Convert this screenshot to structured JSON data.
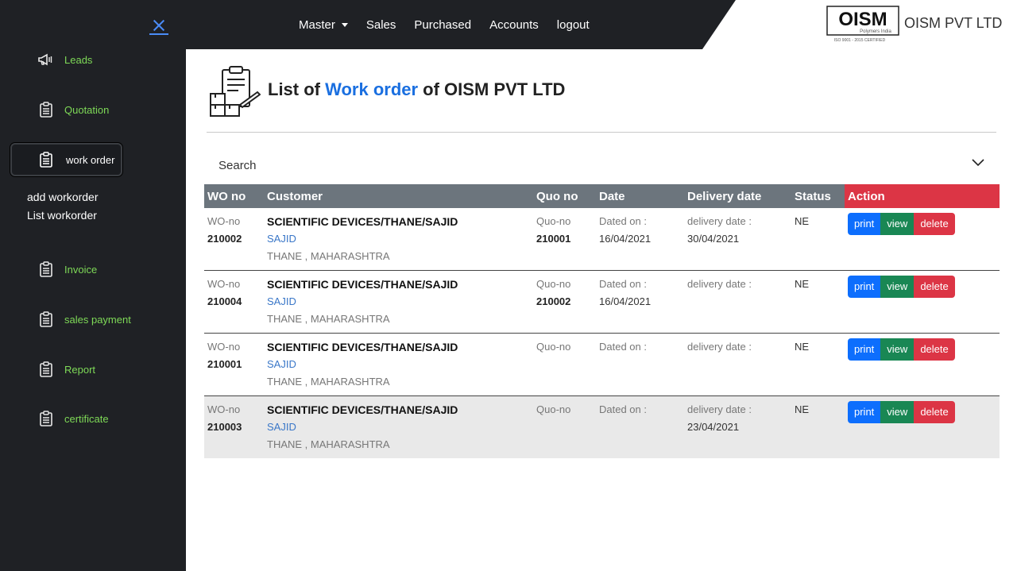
{
  "sidebar": {
    "items": [
      {
        "label": "Leads",
        "icon": "megaphone-icon"
      },
      {
        "label": "Quotation",
        "icon": "clipboard-icon"
      },
      {
        "label": "work order",
        "icon": "clipboard-icon"
      },
      {
        "label": "Invoice",
        "icon": "clipboard-icon"
      },
      {
        "label": "sales payment",
        "icon": "clipboard-icon"
      },
      {
        "label": "Report",
        "icon": "clipboard-icon"
      },
      {
        "label": "certificate",
        "icon": "clipboard-icon"
      }
    ],
    "sub_links": [
      "add workorder",
      "List workorder"
    ]
  },
  "nav": {
    "items": [
      "Master",
      "Sales",
      "Purchased",
      "Accounts",
      "logout"
    ]
  },
  "brand": {
    "logo_text": "OISM",
    "logo_sub": "Polymers India",
    "logo_cert": "ISO 9001 - 2015 CERTIFIED",
    "name": "OISM PVT LTD"
  },
  "page": {
    "title_prefix": "List of ",
    "title_highlight": "Work order",
    "title_suffix": " of OISM PVT LTD",
    "search_label": "Search"
  },
  "table": {
    "headers": [
      "WO no",
      "Customer",
      "Quo no",
      "Date",
      "Delivery date",
      "Status",
      "Action"
    ],
    "wo_label": "WO-no",
    "quo_label": "Quo-no",
    "dated_label": "Dated on :",
    "delivery_label": "delivery date :",
    "buttons": {
      "print": "print",
      "view": "view",
      "delete": "delete"
    },
    "rows": [
      {
        "wo_no": "210002",
        "customer": "SCIENTIFIC DEVICES/THANE/SAJID",
        "contact": "SAJID",
        "location": "THANE , MAHARASHTRA",
        "quo_no": "210001",
        "date": "16/04/2021",
        "delivery": "30/04/2021",
        "status": "NE"
      },
      {
        "wo_no": "210004",
        "customer": "SCIENTIFIC DEVICES/THANE/SAJID",
        "contact": "SAJID",
        "location": "THANE , MAHARASHTRA",
        "quo_no": "210002",
        "date": "16/04/2021",
        "delivery": "",
        "status": "NE"
      },
      {
        "wo_no": "210001",
        "customer": "SCIENTIFIC DEVICES/THANE/SAJID",
        "contact": "SAJID",
        "location": "THANE , MAHARASHTRA",
        "quo_no": "",
        "date": "",
        "delivery": "",
        "status": "NE"
      },
      {
        "wo_no": "210003",
        "customer": "SCIENTIFIC DEVICES/THANE/SAJID",
        "contact": "SAJID",
        "location": "THANE , MAHARASHTRA",
        "quo_no": "",
        "date": "",
        "delivery": "23/04/2021",
        "status": "NE"
      }
    ]
  },
  "colors": {
    "sidebar_bg": "#1f2125",
    "sidebar_text": "#7ed957",
    "accent_blue": "#1a6fe0",
    "header_gray": "#6c757d",
    "header_red": "#dc3545",
    "btn_print": "#0d6efd",
    "btn_view": "#198754",
    "btn_delete": "#dc3545"
  }
}
